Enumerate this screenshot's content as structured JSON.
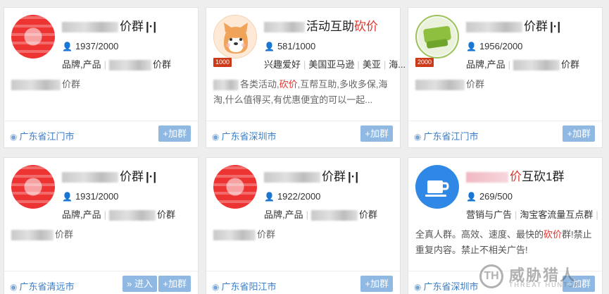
{
  "cards": [
    {
      "title": "价群",
      "title_suffix": "",
      "level": "",
      "members": "1937/2000",
      "tags": [
        "品牌,产品"
      ],
      "tag_tail": "价群",
      "desc": "价群",
      "location": "广东省江门市",
      "join": "+加群"
    },
    {
      "title": "活动互助",
      "title_suffix": "砍价",
      "level": "1000",
      "members": "581/1000",
      "tags": [
        "兴趣爱好",
        "美国亚马逊",
        "美亚",
        "海..."
      ],
      "desc_lead": "各类活动,",
      "desc_hl": "砍价",
      "desc_rest": ",互帮互助,多收多保,海淘,什么值得买,有优惠便宜的可以一起...",
      "location": "广东省深圳市",
      "join": "+加群"
    },
    {
      "title": "价群",
      "title_suffix": "",
      "level": "2000",
      "members": "1956/2000",
      "tags": [
        "品牌,产品"
      ],
      "tag_tail": "价群",
      "desc": "价群",
      "location": "广东省江门市",
      "join": "+加群"
    },
    {
      "title": "价群",
      "title_suffix": "",
      "level": "",
      "members": "1931/2000",
      "tags": [
        "品牌,产品"
      ],
      "tag_tail": "价群",
      "desc": "价群",
      "location": "广东省清远市",
      "join": "+加群",
      "enter": "» 进入"
    },
    {
      "title": "价群",
      "title_suffix": "",
      "level": "",
      "members": "1922/2000",
      "tags": [
        "品牌,产品"
      ],
      "tag_tail": "价群",
      "desc": "价群",
      "location": "广东省阳江市",
      "join": "+加群"
    },
    {
      "title_hl": "价",
      "title": "互砍1群",
      "level": "",
      "members": "269/500",
      "tags": [
        "营销与广告",
        "淘宝客流量互点群"
      ],
      "desc_lead": "全真人群。高效、速度、最快的",
      "desc_hl": "砍价",
      "desc_rest": "群!禁止重复内容。禁止不相关广告!",
      "location": "广东省深圳市",
      "join": "+加群"
    }
  ],
  "watermark": {
    "logo": "TH",
    "cn": "威胁猎人",
    "en": "THREAT HUNTER"
  },
  "colors": {
    "link": "#3a7ec7",
    "button": "#8fb8e3",
    "highlight": "#e0332c",
    "level_badge": "#cc3a1a"
  }
}
